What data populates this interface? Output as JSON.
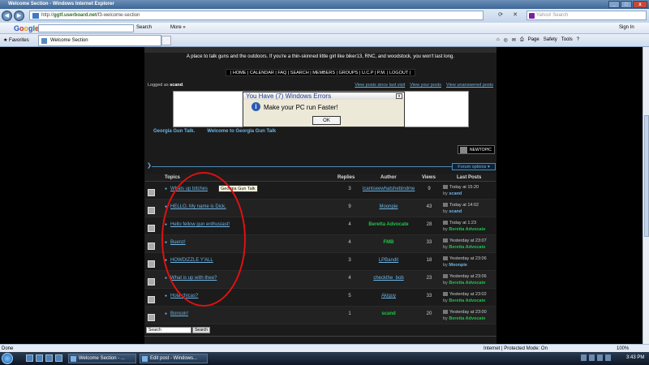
{
  "window": {
    "title": "Welcome Section - Windows Internet Explorer",
    "controls": {
      "min": "_",
      "max": "□",
      "close": "x"
    }
  },
  "address": {
    "url_prefix": "http://",
    "url_domain": "ggtf.userboard.net",
    "url_path": "/f3-welcome-section",
    "search_placeholder": "Yahoo! Search"
  },
  "google_bar": {
    "logo": [
      "G",
      "o",
      "o",
      "g",
      "l",
      "e"
    ],
    "search_label": "Search",
    "more_label": "More",
    "sign_in": "Sign In"
  },
  "tabs": {
    "favorites": "Favorites",
    "active_tab": "Welcome Section",
    "commands": [
      "Page",
      "Safety",
      "Tools"
    ]
  },
  "forum": {
    "tagline": "A place to talk guns and the outdoors. If you're a thin-skinned little girl like biker13, RNC, and woodstock, you won't last long.",
    "menu": "| HOME | CALENDAR | FAQ | SEARCH | MEMBERS | GROUPS | U.C.P | P.M. | LOGOUT |",
    "logged_prefix": "Logged as",
    "logged_user": "scand",
    "top_links": [
      "View posts since last visit",
      "View your posts",
      "View unanswered posts"
    ],
    "popup": {
      "title": "You Have (7) Windows Errors",
      "message": "Make your PC run Faster!",
      "ok": "OK",
      "close": "x"
    },
    "breadcrumbs": [
      "Georgia Gun Talk.",
      "Welcome to Georgia Gun Talk"
    ],
    "new_topic": "NEWTOPIC",
    "forum_options": "Forum options ▾",
    "columns": {
      "topics": "Topics",
      "replies": "Replies",
      "author": "Author",
      "views": "Views",
      "last_posts": "Last Posts"
    },
    "tooltip": "Georgia Gun Talk",
    "topics": [
      {
        "title": "Whats up bitches",
        "replies": "3",
        "author": "icantseewhatshebindme",
        "author_bold": false,
        "views": "9",
        "last_time": "Today at 15:20",
        "last_by": "scand",
        "last_green": false
      },
      {
        "title": "HELLO, My name is Dick.",
        "replies": "9",
        "author": "Moonpie",
        "author_bold": false,
        "views": "43",
        "last_time": "Today at 14:02",
        "last_by": "scand",
        "last_green": false
      },
      {
        "title": "Hello fellow gun enthusiast!",
        "replies": "4",
        "author": "Beretta Advocate",
        "author_bold": true,
        "views": "28",
        "last_time": "Today at 1:23",
        "last_by": "Beretta Advocate",
        "last_green": true
      },
      {
        "title": "Buenz!",
        "replies": "4",
        "author": "FMB",
        "author_bold": true,
        "views": "33",
        "last_time": "Yesterday at 23:07",
        "last_by": "Beretta Advocate",
        "last_green": true
      },
      {
        "title": "HOWDIZZLE Y'ALL",
        "replies": "3",
        "author": "LPBandit",
        "author_bold": false,
        "views": "18",
        "last_time": "Yesterday at 23:06",
        "last_by": "Moonpie",
        "last_green": false
      },
      {
        "title": "What is up with thee?",
        "replies": "4",
        "author": "checkthe_bob",
        "author_bold": false,
        "views": "23",
        "last_time": "Yesterday at 23:06",
        "last_by": "Beretta Advocate",
        "last_green": true
      },
      {
        "title": "Hola chicas?",
        "replies": "5",
        "author": "Akiguy",
        "author_bold": false,
        "views": "33",
        "last_time": "Yesterday at 23:02",
        "last_by": "Beretta Advocate",
        "last_green": true
      },
      {
        "title": "Bonsoir!",
        "replies": "1",
        "author": "scand",
        "author_bold": true,
        "views": "20",
        "last_time": "Yesterday at 23:00",
        "last_by": "Beretta Advocate",
        "last_green": true
      }
    ],
    "by_label": "by",
    "bottom_search_value": "Search",
    "bottom_search_button": "Search"
  },
  "status": {
    "left": "Done",
    "zone": "Internet | Protected Mode: On",
    "zoom": "100%"
  },
  "taskbar": {
    "items": [
      "Welcome Section - ...",
      "Edit post - Windows..."
    ],
    "clock": "3:43 PM"
  },
  "colors": {
    "link": "#6cb4e4",
    "author_green": "#1ec44a",
    "circle": "#e01010"
  }
}
